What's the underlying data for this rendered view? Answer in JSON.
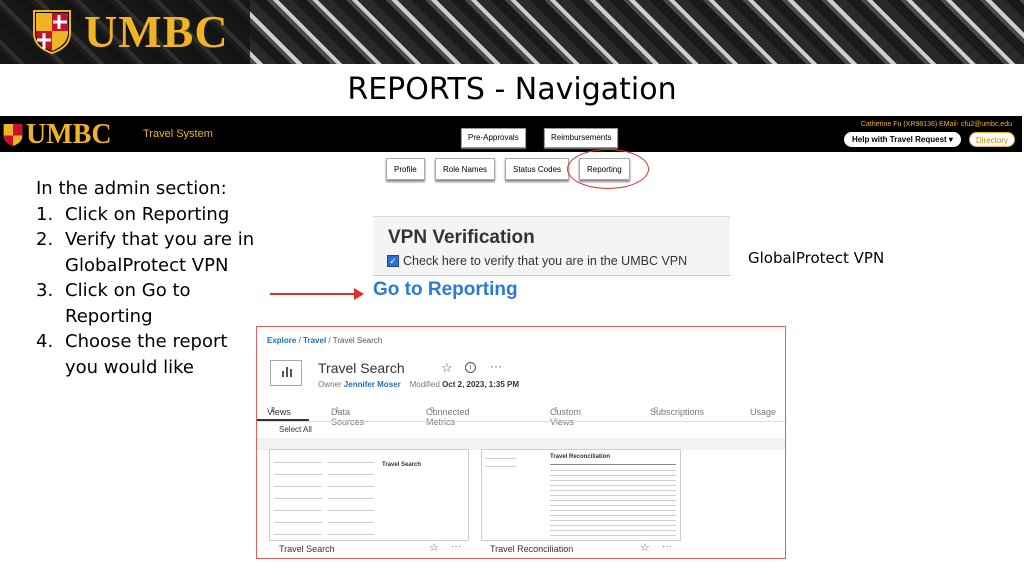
{
  "banner": {
    "logo_text": "UMBC"
  },
  "slide": {
    "title": "REPORTS - Navigation"
  },
  "travel_system": {
    "logo_text": "UMBC",
    "subtitle": "Travel System",
    "nav": [
      "Pre-Approvals",
      "Reimbursements"
    ],
    "user_info": "Catherine Fu (XR98136) EMail- cfu2@umbc.edu",
    "help_label": "Help with Travel Request ▾",
    "directory_label": "Directory"
  },
  "admin_tabs": [
    "Profile",
    "Role Names",
    "Status Codes",
    "Reporting"
  ],
  "instructions": {
    "heading": "In the admin section:",
    "steps": [
      {
        "num": "1.",
        "text": "Click on Reporting"
      },
      {
        "num": "2.",
        "text": "Verify that you are in GlobalProtect VPN"
      },
      {
        "num": "3.",
        "text": "Click on Go to Reporting"
      },
      {
        "num": "4.",
        "text": "Choose the report you would like"
      }
    ]
  },
  "vpn": {
    "title": "VPN Verification",
    "checkbox_label": "Check here to verify that you are in the UMBC VPN",
    "checked": true,
    "go_link": "Go to Reporting",
    "note": "GlobalProtect VPN"
  },
  "tableau": {
    "breadcrumb": {
      "explore": "Explore",
      "sep1": "/",
      "travel": "Travel",
      "sep2": "/",
      "current": "Travel Search"
    },
    "workbook_title": "Travel Search",
    "owner_label": "Owner",
    "owner": "Jennifer Moser",
    "modified_label": "Modified",
    "modified": "Oct 2, 2023, 1:35 PM",
    "tabs": [
      {
        "label": "Views",
        "count": "2"
      },
      {
        "label": "Data Sources",
        "count": "1"
      },
      {
        "label": "Connected Metrics",
        "count": "0"
      },
      {
        "label": "Custom Views",
        "count": "1"
      },
      {
        "label": "Subscriptions",
        "count": "0"
      },
      {
        "label": "Usage",
        "count": ""
      }
    ],
    "select_all": "Select All",
    "views": [
      {
        "name": "Travel Search",
        "preview_title": "Travel Search"
      },
      {
        "name": "Travel Reconciliation",
        "preview_title": "Travel Reconciliation"
      }
    ]
  },
  "colors": {
    "umbc_gold": "#f0b323",
    "link_blue": "#2a7ad8",
    "annotation_red": "#d93030"
  },
  "icons": [
    "umbc-shield-icon",
    "checkbox-icon",
    "arrow-right-icon",
    "bar-chart-icon",
    "star-icon",
    "info-icon",
    "more-icon"
  ]
}
